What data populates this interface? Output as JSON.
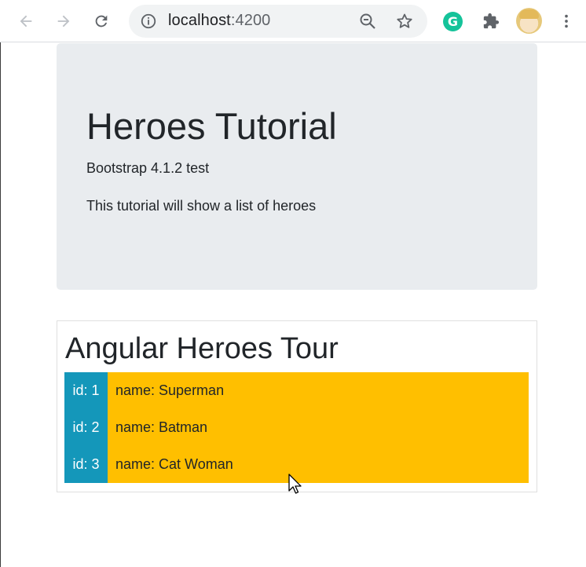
{
  "browser": {
    "url_host": "localhost",
    "url_port": ":4200",
    "icons": [
      "back-arrow-icon",
      "forward-arrow-icon",
      "reload-icon",
      "info-icon",
      "zoom-out-icon",
      "star-icon",
      "grammarly-icon",
      "puzzle-icon",
      "avatar",
      "more-vert-icon"
    ],
    "grammarly_letter": "G"
  },
  "jumbotron": {
    "title": "Heroes Tutorial",
    "subtitle": "Bootstrap 4.1.2 test",
    "description": "This tutorial will show a list of heroes"
  },
  "tour": {
    "title": "Angular Heroes Tour",
    "heroes": [
      {
        "id": "id: 1",
        "name": "name: Superman"
      },
      {
        "id": "id: 2",
        "name": "name: Batman"
      },
      {
        "id": "id: 3",
        "name": "name: Cat Woman"
      }
    ]
  },
  "colors": {
    "jumbotron_bg": "#e9ecef",
    "id_cell": "#1497ba",
    "name_cell": "#ffbf00",
    "grammarly": "#15c39a"
  }
}
